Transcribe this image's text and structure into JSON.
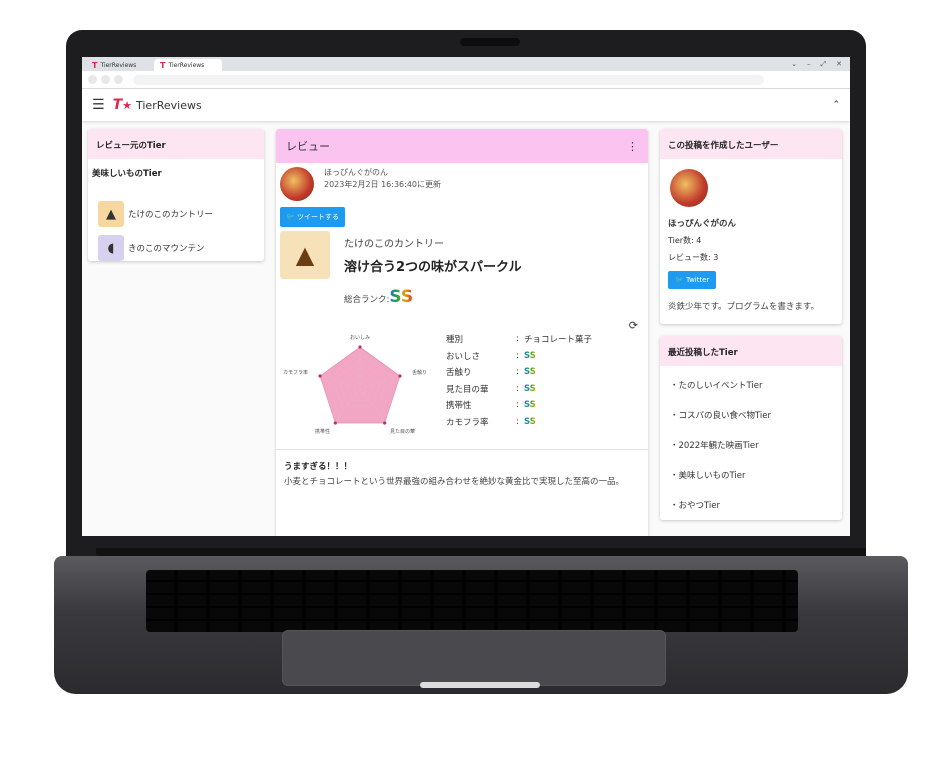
{
  "browser": {
    "tabs": [
      {
        "label": "TierReviews",
        "icon": "T"
      },
      {
        "label": "TierReviews",
        "icon": "T"
      }
    ],
    "window_controls": [
      "⌄",
      "–",
      "⤢",
      "✕"
    ]
  },
  "app": {
    "logo_mark": "T",
    "brand": "TierReviews",
    "collapse_icon": "⌃"
  },
  "left": {
    "header": "レビュー元のTier",
    "tier_title": "美味しいものTier",
    "items": [
      {
        "label": "たけのこのカントリー",
        "icon": "takenoko-icon"
      },
      {
        "label": "きのこのマウンテン",
        "icon": "kinoko-icon"
      }
    ]
  },
  "review": {
    "header": "レビュー",
    "menu_icon": "⋮",
    "user_name": "ほっぴんぐがのん",
    "updated": "2023年2月2日 16:36:40に更新",
    "tweet_label": "ツイートする",
    "product_name": "たけのこのカントリー",
    "title": "溶け合う2つの味がスパークル",
    "rank_label": "総合ランク:",
    "rank_value": "SS",
    "radar_labels": [
      "おいしみ",
      "舌触り",
      "見た目の華",
      "携帯性",
      "カモフラ率"
    ],
    "stats": [
      {
        "key": "種別",
        "value": "チョコレート菓子"
      },
      {
        "key": "おいしさ",
        "value": "SS"
      },
      {
        "key": "舌触り",
        "value": "SS"
      },
      {
        "key": "見た目の華",
        "value": "SS"
      },
      {
        "key": "携帯性",
        "value": "SS"
      },
      {
        "key": "カモフラ率",
        "value": "SS"
      }
    ],
    "stat_separator": ":",
    "body_title": "うますぎる！！！",
    "body": "小麦とチョコレートという世界最強の組み合わせを絶妙な黄金比で実現した至高の一品。"
  },
  "right": {
    "user_header": "この投稿を作成したユーザー",
    "user_name": "ほっぴんぐがのん",
    "tier_count": "Tier数: 4",
    "review_count": "レビュー数: 3",
    "twitter_label": "Twitter",
    "bio": "炎鉄少年です。プログラムを書きます。",
    "recent_header": "最近投稿したTier",
    "recent": [
      "・たのしいイベントTier",
      "・コスパの良い食べ物Tier",
      "・2022年観た映画Tier",
      "・美味しいものTier",
      "・おやつTier"
    ]
  },
  "colors": {
    "accent": "#e0284f",
    "review_header": "#fbc3ef",
    "side_header": "#fde6f2",
    "twitter": "#1d9bf0",
    "radar_fill": "#f3a6c4"
  }
}
